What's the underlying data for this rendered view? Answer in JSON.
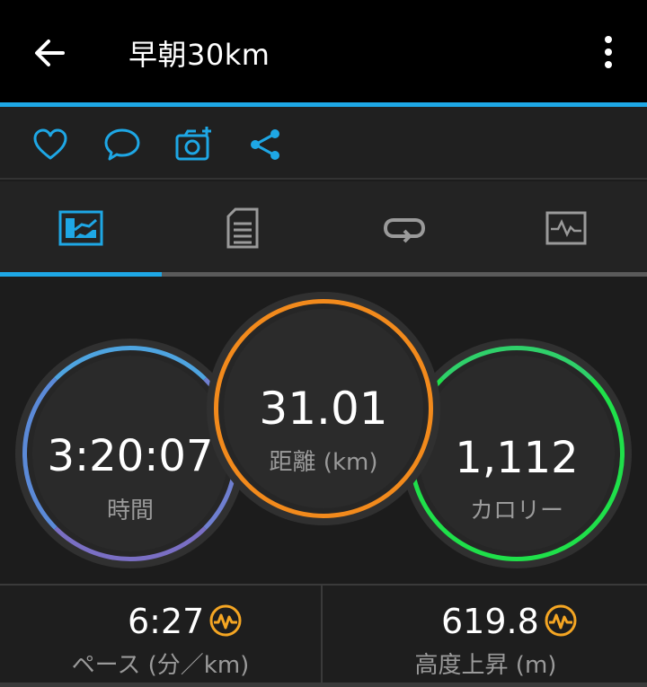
{
  "header": {
    "title": "早朝30km"
  },
  "icons": {
    "back": "arrow-left-icon",
    "more": "more-vertical-icon",
    "like": "heart-icon",
    "comment": "comment-icon",
    "photo": "camera-add-icon",
    "share": "share-icon"
  },
  "tabs": [
    "overview-icon",
    "details-icon",
    "laps-icon",
    "graphs-icon"
  ],
  "stats": {
    "time": {
      "value": "3:20:07",
      "label": "時間"
    },
    "distance": {
      "value": "31.01",
      "label": "距離 (km)"
    },
    "calories": {
      "value": "1,112",
      "label": "カロリー"
    }
  },
  "metrics": {
    "pace": {
      "value": "6:27",
      "label": "ペース (分／km)"
    },
    "elevation": {
      "value": "619.8",
      "label": "高度上昇 (m)"
    }
  },
  "colors": {
    "accent": "#1ea7e5",
    "distance_ring": "#f28a1c",
    "calories_ring": "#1fe04a",
    "time_ring": "#4ea4e0"
  }
}
